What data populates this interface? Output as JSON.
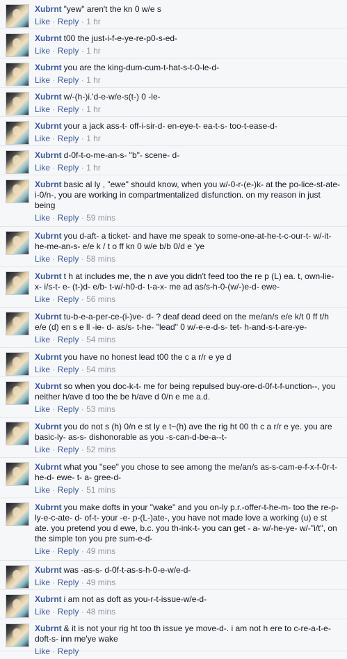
{
  "labels": {
    "like": "Like",
    "reply": "Reply",
    "sep": "·"
  },
  "comments": [
    {
      "author": "Xubrnt",
      "text": "\"yew\" aren't the kn 0 w/e s",
      "time": "1 hr"
    },
    {
      "author": "Xubrnt",
      "text": "t00 the just-i-f-e-ye-re-p0-s-ed-",
      "time": "1 hr"
    },
    {
      "author": "Xubrnt",
      "text": "you are the king-dum-cum-t-hat-s-t-0-le-d-",
      "time": "1 hr"
    },
    {
      "author": "Xubrnt",
      "text": "w/-(h-)i.'d-e-w/e-s(t-) 0 -le-",
      "time": "1 hr"
    },
    {
      "author": "Xubrnt",
      "text": "your a jack ass-t- off-i-sir-d- en-eye-t- ea-t-s- too-t-ease-d-",
      "time": "1 hr"
    },
    {
      "author": "Xubrnt",
      "text": "d-0f-t-o-me-an-s- \"b\"- scene- d-",
      "time": "1 hr"
    },
    {
      "author": "Xubrnt",
      "text": "basic al ly , \"ewe\" should know, when you w/-0-r-(e-)k- at the po-lice-st-ate-i-0/n-, you are working in compartmentalized disfunction. on my reason in just being",
      "time": "59 mins"
    },
    {
      "author": "Xubrnt",
      "text": "you d-aft- a ticket- and have me speak to some-one-at-he-t-c-our-t- w/-it- he-me-an-s- e/e k / t o ff kn 0 w/e b/b 0/d e 'ye",
      "time": "58 mins"
    },
    {
      "author": "Xubrnt",
      "text": "t h at includes me, the n ave you didn't feed too the re p (L) ea. t, own-lie- x- i/s-t- e- (t-)d- e/b- t-w/-h0-d- t-a-x- me ad as/s-h-0-(w/-)e-d- ewe-",
      "time": "56 mins"
    },
    {
      "author": "Xubrnt",
      "text": "tu-b-e-a-per-ce-(i-)ve- d- ? deaf dead deed on the me/an/s e/e k/t 0 ff t/h e/e (d) en s e ll -ie- d- as/s- t-he- \"lead\" 0 w/-e-e-d-s- tet- h-and-s-t-are-ye-",
      "time": "54 mins"
    },
    {
      "author": "Xubrnt",
      "text": "you have no honest lead t00 the c a r/r e ye d",
      "time": "54 mins"
    },
    {
      "author": "Xubrnt",
      "text": "so when you doc-k-t- me for being repulsed buy-ore-d-0f-t-f-unction--, you neither h/ave d too the be h/ave d 0/n e me a.d.",
      "time": "53 mins"
    },
    {
      "author": "Xubrnt",
      "text": "you do not s (h) 0/n e st ly e t~(h) ave the rig ht 00 th c a r/r e ye. you are basic-ly- as-s- dishonorable as you -s-can-d-be-a--t-",
      "time": "52 mins"
    },
    {
      "author": "Xubrnt",
      "text": "what you \"see\" you chose to see among the me/an/s as-s-cam-e-f-x-f-0r-t-he-d- ewe- t- a- gree-d-",
      "time": "51 mins"
    },
    {
      "author": "Xubrnt",
      "text": "you make dofts in your \"wake\" and you on-ly p.r.-offer-t-he-m- too the re-p-ly-e-c-ate- d- of-t- your -e- p-(L-)ate-, you have not made love a working (u) e st ate. you pretend you d ewe, b.c. you th-ink-t- you can get - a- w/-he-ye- w/-\"i/t\", on the simple ton you pre sum-e-d-",
      "time": "49 mins"
    },
    {
      "author": "Xubrnt",
      "text": "was -as-s- d-0f-t-as-s-h-0-e-w/e-d-",
      "time": "49 mins"
    },
    {
      "author": "Xubrnt",
      "text": "i am not as doft as you-r-t-issue-w/e-d-",
      "time": "48 mins"
    },
    {
      "author": "Xubrnt",
      "text": "& it is not your rig ht too th issue ye move-d-. i am not h ere to c-re-a-t-e- doft-s- inn me'ye wake",
      "time": ""
    }
  ]
}
